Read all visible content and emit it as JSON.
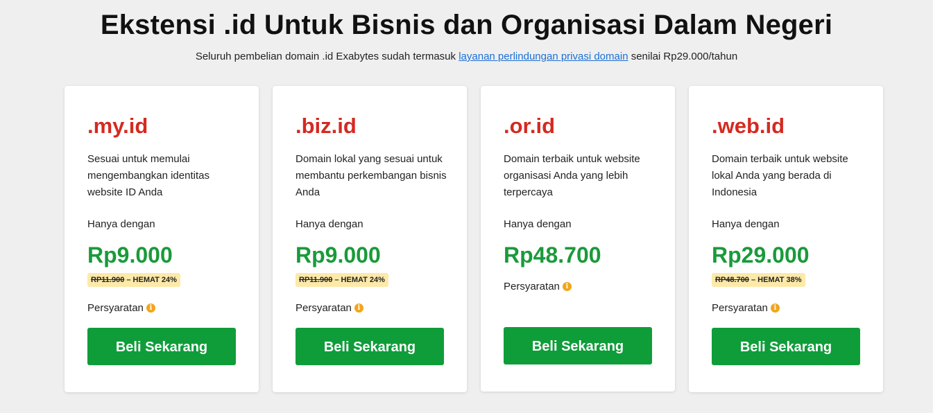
{
  "header": {
    "title": "Ekstensi .id Untuk Bisnis dan Organisasi Dalam Negeri",
    "subtitle_before": "Seluruh pembelian domain .id Exabytes sudah termasuk ",
    "subtitle_link": "layanan perlindungan privasi domain",
    "subtitle_after": " senilai Rp29.000/tahun"
  },
  "colors": {
    "extension_red": "#d42a20",
    "price_green": "#1a9a3a",
    "button_green": "#0f9d3a",
    "badge_yellow": "#fde9a8",
    "info_orange": "#f2a51a",
    "link_blue": "#1a6fd6"
  },
  "cards": [
    {
      "extension": ".my.id",
      "description": "Sesuai untuk memulai mengembangkan identitas website ID Anda",
      "only_with": "Hanya dengan",
      "price": "Rp9.000",
      "old_price": "RP11.900",
      "saving": " – HEMAT 24%",
      "terms": "Persyaratan",
      "info_icon": "info-icon",
      "button": "Beli Sekarang"
    },
    {
      "extension": ".biz.id",
      "description": "Domain lokal yang sesuai untuk membantu perkembangan bisnis Anda",
      "only_with": "Hanya dengan",
      "price": "Rp9.000",
      "old_price": "RP11.900",
      "saving": " – HEMAT 24%",
      "terms": "Persyaratan",
      "info_icon": "info-icon",
      "button": "Beli Sekarang"
    },
    {
      "extension": ".or.id",
      "description": "Domain terbaik untuk website organisasi Anda yang lebih terpercaya",
      "only_with": "Hanya dengan",
      "price": "Rp48.700",
      "terms": "Persyaratan",
      "info_icon": "info-icon",
      "button": "Beli Sekarang"
    },
    {
      "extension": ".web.id",
      "description": "Domain terbaik untuk website lokal Anda yang berada di Indonesia",
      "only_with": "Hanya dengan",
      "price": "Rp29.000",
      "old_price": "RP48.700",
      "saving": " – HEMAT 38%",
      "terms": "Persyaratan",
      "info_icon": "info-icon",
      "button": "Beli Sekarang"
    }
  ]
}
